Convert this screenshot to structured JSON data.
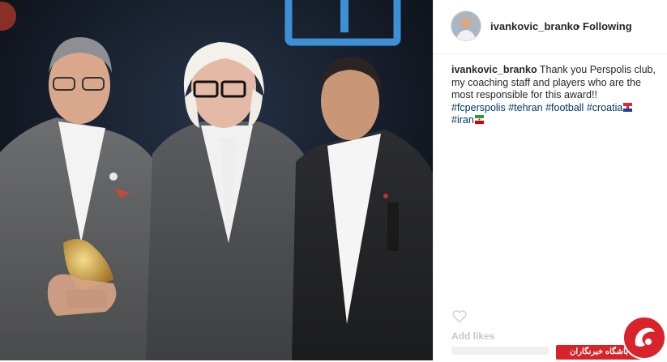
{
  "post": {
    "username": "ivankovic_branko",
    "separator": "•",
    "follow_status": "Following",
    "caption_user": "ivankovic_branko",
    "caption_text": "Thank you Perspolis club, my coaching staff and players who are the most responsible for this award!!",
    "hashtags": [
      "#fcperspolis",
      "#tehran",
      "#football",
      "#croatia",
      "#iran"
    ],
    "faded_text": "Add likes"
  },
  "watermark": {
    "text": "باشگاه خبرنگاران"
  },
  "colors": {
    "hashtag": "#003569",
    "watermark_red": "#d8232a",
    "text": "#262626"
  },
  "icons": {
    "croatia_flag": "croatia-flag-icon",
    "iran_flag": "iran-flag-icon",
    "heart": "heart-icon"
  }
}
